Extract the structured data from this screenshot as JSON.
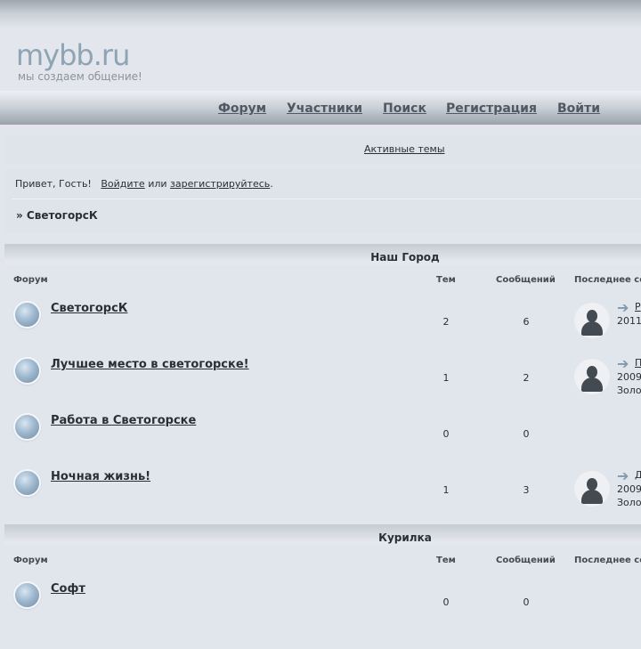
{
  "logo": {
    "text": "mybb.ru",
    "tagline": "мы создаем общение!"
  },
  "nav": [
    "Форум",
    "Участники",
    "Поиск",
    "Регистрация",
    "Войти"
  ],
  "active_topics": "Активные темы",
  "greeting": {
    "prefix": "Привет, Гость!",
    "login": "Войдите",
    "or": "или",
    "register": "зарегистрируйтесь",
    "suffix": "."
  },
  "breadcrumb": "» СветогорсК",
  "columns": {
    "forum": "Форум",
    "topics": "Тем",
    "posts": "Сообщений",
    "last_post": "Последнее со"
  },
  "categories": [
    {
      "title": "Наш Город",
      "forums": [
        {
          "name": "СветогорсК",
          "topics": "2",
          "posts": "6",
          "last_link": "Р",
          "last_line2": "2011",
          "last_line3": ""
        },
        {
          "name": "Лучшее место в светогорске!",
          "topics": "1",
          "posts": "2",
          "last_link": "П",
          "last_line2": "2009",
          "last_line3": "Золо"
        },
        {
          "name": "Работа в Светогорске",
          "topics": "0",
          "posts": "0",
          "last_link": "",
          "last_line2": "",
          "last_line3": ""
        },
        {
          "name": "Ночная жизнь!",
          "topics": "1",
          "posts": "3",
          "last_link": "Д",
          "last_line2": "2009",
          "last_line3": "Золо"
        }
      ]
    },
    {
      "title": "Курилка",
      "forums": [
        {
          "name": "Софт",
          "topics": "0",
          "posts": "0",
          "last_link": "",
          "last_line2": "",
          "last_line3": ""
        }
      ]
    }
  ],
  "icons": {
    "forum": "forum-bubble-icon",
    "avatar": "user-avatar-icon",
    "arrow": "go-to-last-post-arrow-icon"
  },
  "colors": {
    "background": "#e2e5ec",
    "logo": "#8ea4b4",
    "nav_text": "#4f5863",
    "forum_ball": "#9fb9cf"
  }
}
